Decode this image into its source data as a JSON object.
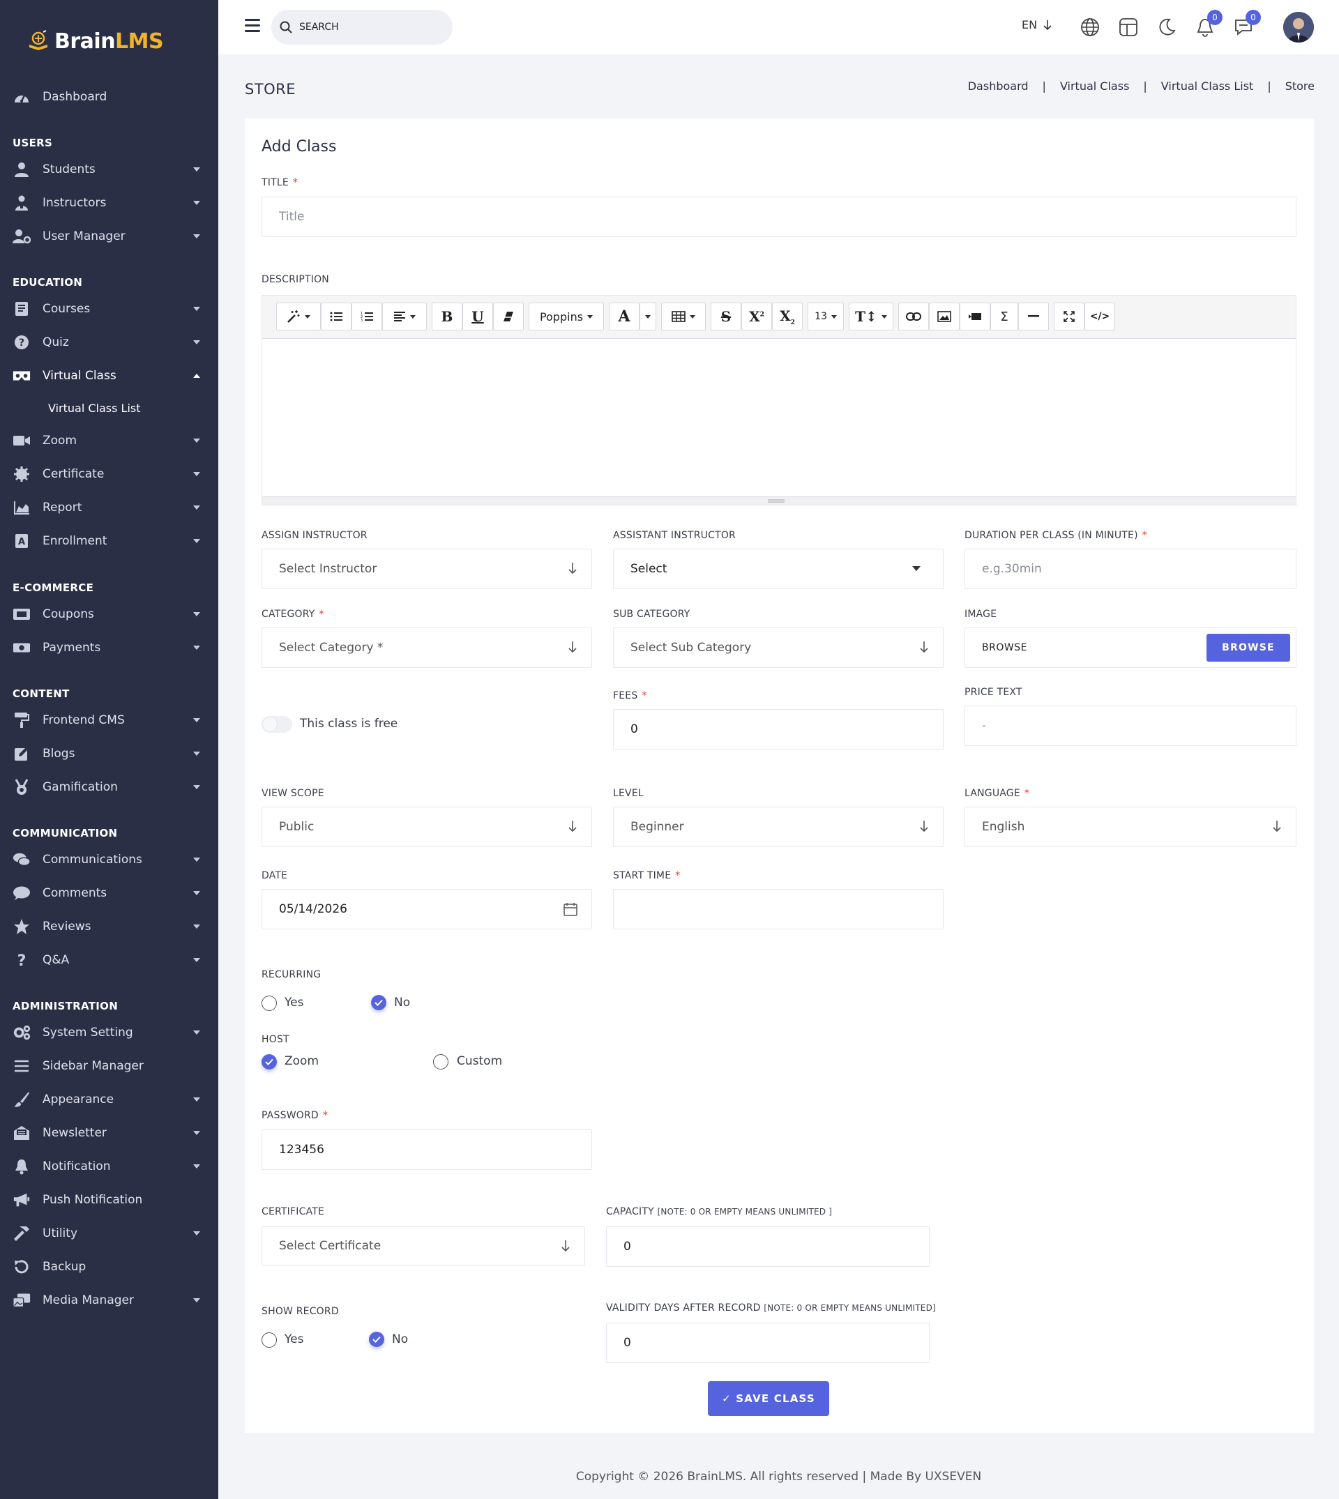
{
  "brand": {
    "name_part1": "Brain",
    "name_part2": "LMS",
    "accent": "#f0b429"
  },
  "colors": {
    "sidebar_bg": "#2b2f46",
    "primary": "#5563de",
    "required": "#e53935"
  },
  "sidebar": {
    "dashboard": "Dashboard",
    "sections": {
      "users": "USERS",
      "education": "EDUCATION",
      "ecommerce": "E-COMMERCE",
      "content": "CONTENT",
      "communication": "COMMUNICATION",
      "administration": "ADMINISTRATION"
    },
    "items": {
      "students": "Students",
      "instructors": "Instructors",
      "user_manager": "User Manager",
      "courses": "Courses",
      "quiz": "Quiz",
      "virtual_class": "Virtual Class",
      "virtual_class_list": "Virtual Class List",
      "zoom": "Zoom",
      "certificate": "Certificate",
      "report": "Report",
      "enrollment": "Enrollment",
      "coupons": "Coupons",
      "payments": "Payments",
      "frontend_cms": "Frontend CMS",
      "blogs": "Blogs",
      "gamification": "Gamification",
      "communications": "Communications",
      "comments": "Comments",
      "reviews": "Reviews",
      "qa": "Q&A",
      "system_setting": "System Setting",
      "sidebar_manager": "Sidebar Manager",
      "appearance": "Appearance",
      "newsletter": "Newsletter",
      "notification": "Notification",
      "push_notification": "Push Notification",
      "utility": "Utility",
      "backup": "Backup",
      "media_manager": "Media Manager"
    }
  },
  "topbar": {
    "search_placeholder": "SEARCH",
    "language": "EN",
    "notifications_count": "0",
    "messages_count": "0"
  },
  "page": {
    "title": "STORE",
    "breadcrumbs": [
      "Dashboard",
      "Virtual Class",
      "Virtual Class List",
      "Store"
    ]
  },
  "form": {
    "heading": "Add Class",
    "title_label": "TITLE",
    "title_placeholder": "Title",
    "description_label": "DESCRIPTION",
    "editor": {
      "font": "Poppins",
      "font_size": "13"
    },
    "assign_instructor_label": "ASSIGN INSTRUCTOR",
    "assign_instructor_value": "Select Instructor",
    "assistant_instructor_label": "ASSISTANT INSTRUCTOR",
    "assistant_instructor_value": "Select",
    "duration_label": "DURATION PER CLASS (IN MINUTE)",
    "duration_placeholder": "e.g.30min",
    "category_label": "CATEGORY",
    "category_value": "Select Category *",
    "sub_category_label": "SUB CATEGORY",
    "sub_category_value": "Select Sub Category",
    "image_label": "IMAGE",
    "image_text": "BROWSE",
    "browse_button": "BROWSE",
    "free_toggle_label": "This class is free",
    "free_toggle_on": false,
    "fees_label": "FEES",
    "fees_value": "0",
    "price_text_label": "PRICE TEXT",
    "price_text_placeholder": "-",
    "view_scope_label": "VIEW SCOPE",
    "view_scope_value": "Public",
    "level_label": "LEVEL",
    "level_value": "Beginner",
    "language_label": "LANGUAGE",
    "language_value": "English",
    "date_label": "DATE",
    "date_value": "05/14/2026",
    "start_time_label": "START TIME",
    "start_time_value": "",
    "recurring_label": "RECURRING",
    "recurring_options": [
      "Yes",
      "No"
    ],
    "recurring_selected": "No",
    "host_label": "HOST",
    "host_options": [
      "Zoom",
      "Custom"
    ],
    "host_selected": "Zoom",
    "password_label": "PASSWORD",
    "password_value": "123456",
    "certificate_label": "CERTIFICATE",
    "certificate_value": "Select Certificate",
    "capacity_label": "CAPACITY",
    "capacity_note": "[NOTE: 0 OR EMPTY MEANS UNLIMITED ]",
    "capacity_value": "0",
    "show_record_label": "SHOW RECORD",
    "show_record_options": [
      "Yes",
      "No"
    ],
    "show_record_selected": "No",
    "validity_label": "VALIDITY DAYS AFTER RECORD",
    "validity_note": "[NOTE: 0 OR EMPTY MEANS UNLIMITED]",
    "validity_value": "0",
    "save_button": "✓ SAVE CLASS"
  },
  "footer": {
    "text": "Copyright © 2026 BrainLMS. All rights reserved | Made By UXSEVEN"
  }
}
